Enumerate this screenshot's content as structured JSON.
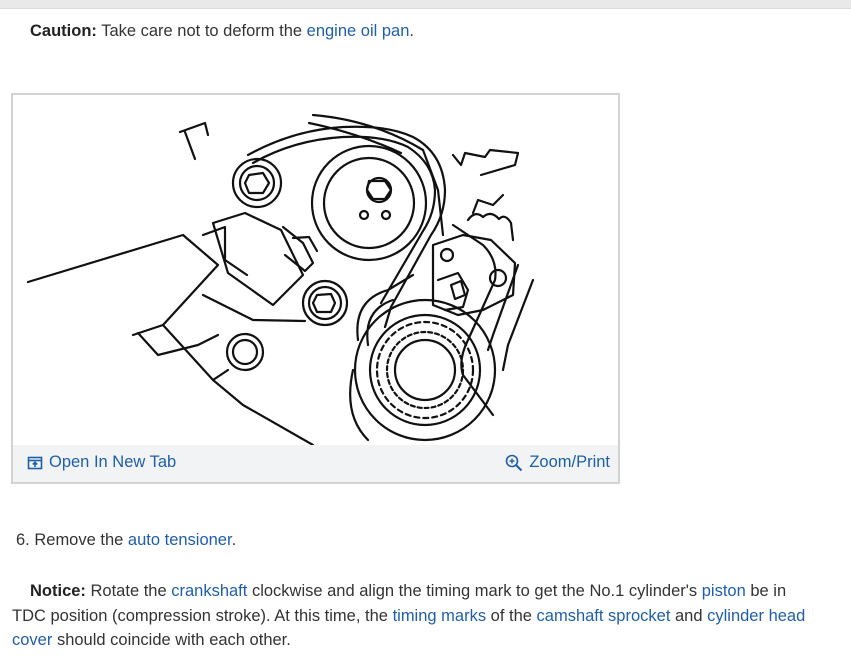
{
  "caution": {
    "label": "Caution:",
    "text": " Take care not to deform the ",
    "link": "engine oil pan",
    "end": "."
  },
  "figure": {
    "open_tab_label": "Open In New Tab",
    "zoom_label": "Zoom/Print",
    "icons": [
      "open-new-tab-icon",
      "zoom-icon"
    ]
  },
  "step6": {
    "number": "6.",
    "text": " Remove the ",
    "link": "auto tensioner",
    "end": "."
  },
  "notice": {
    "label": "Notice:",
    "t1": " Rotate the ",
    "link1": "crankshaft",
    "t2": " clockwise and align the timing mark to get the No.1 cylinder's ",
    "link2": "piston",
    "t3": " be in TDC position (compression stroke). At this time, the ",
    "link3": "timing marks",
    "t4": " of the ",
    "link4": "camshaft sprocket",
    "t5": " and ",
    "link5": "cylinder head cover",
    "t6": " should coincide with each other."
  },
  "colors": {
    "link": "#1f5fa8",
    "text": "#333333",
    "figure_bar": "#f1f3f5"
  }
}
